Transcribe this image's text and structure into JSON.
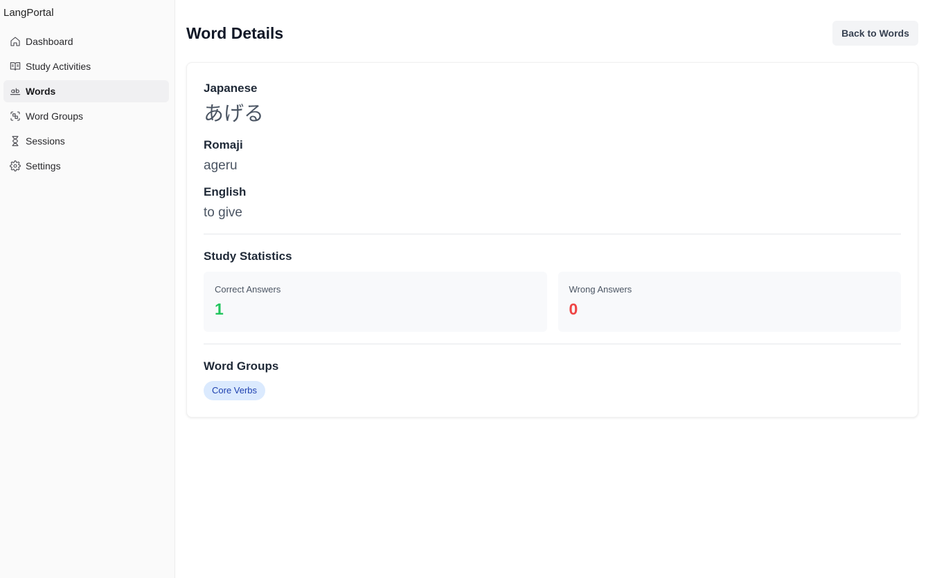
{
  "app": {
    "name": "LangPortal"
  },
  "sidebar": {
    "items": [
      {
        "label": "Dashboard",
        "icon": "home-icon",
        "active": false
      },
      {
        "label": "Study Activities",
        "icon": "book-open-icon",
        "active": false
      },
      {
        "label": "Words",
        "icon": "whole-word-icon",
        "active": true
      },
      {
        "label": "Word Groups",
        "icon": "group-scan-icon",
        "active": false
      },
      {
        "label": "Sessions",
        "icon": "hourglass-icon",
        "active": false
      },
      {
        "label": "Settings",
        "icon": "gear-icon",
        "active": false
      }
    ]
  },
  "header": {
    "title": "Word Details",
    "back_label": "Back to Words"
  },
  "word": {
    "japanese_label": "Japanese",
    "japanese": "あげる",
    "romaji_label": "Romaji",
    "romaji": "ageru",
    "english_label": "English",
    "english": "to give"
  },
  "stats": {
    "title": "Study Statistics",
    "correct_label": "Correct Answers",
    "correct": "1",
    "wrong_label": "Wrong Answers",
    "wrong": "0",
    "correct_color": "#22c55e",
    "wrong_color": "#ef4444"
  },
  "groups": {
    "title": "Word Groups",
    "items": [
      "Core Verbs"
    ]
  }
}
